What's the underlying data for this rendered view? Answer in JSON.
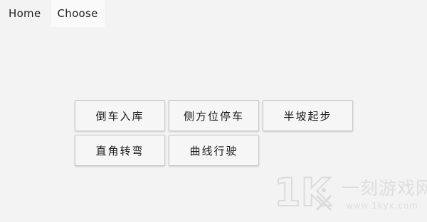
{
  "tabs": [
    {
      "label": "Home",
      "active": false
    },
    {
      "label": "Choose",
      "active": true
    }
  ],
  "buttons": [
    {
      "label": "倒车入库"
    },
    {
      "label": "侧方位停车"
    },
    {
      "label": "半坡起步"
    },
    {
      "label": "直角转弯"
    },
    {
      "label": "曲线行驶"
    }
  ],
  "watermark": {
    "logo_text": "1K",
    "title": "一刻游戏网",
    "url": "www.1kyx.com"
  },
  "colors": {
    "background": "#f3f3f3",
    "active_tab": "#fafafa",
    "button_border": "#c9c9c9",
    "watermark": "#cdcdcd"
  }
}
